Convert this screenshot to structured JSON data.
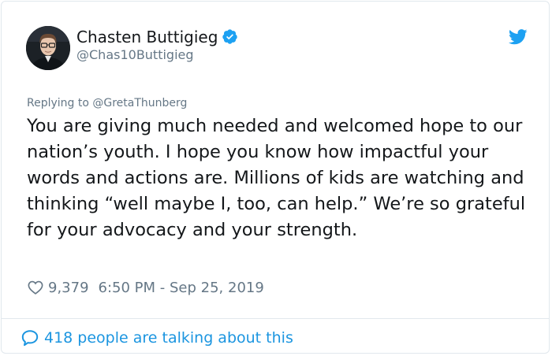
{
  "author": {
    "display_name": "Chasten Buttigieg",
    "handle": "@Chas10Buttigieg",
    "verified": true,
    "avatar_icon": "profile-photo"
  },
  "brand": {
    "icon": "twitter-bird-icon",
    "color": "#1da1f2"
  },
  "tweet": {
    "replying_to": "Replying to @GretaThunberg",
    "text": "You are giving much needed and welcomed hope to our nation’s youth. I hope you know how impactful your words and actions are. Millions of kids are watching and thinking “well maybe I, too, can help.” We’re so grateful for your advocacy and your strength.",
    "likes": "9,379",
    "timestamp": "6:50 PM - Sep 25, 2019"
  },
  "footer": {
    "talking": "418 people are talking about this"
  },
  "colors": {
    "text": "#14171a",
    "secondary": "#657786",
    "link": "#1b95e0",
    "border": "#e1e8ed"
  }
}
